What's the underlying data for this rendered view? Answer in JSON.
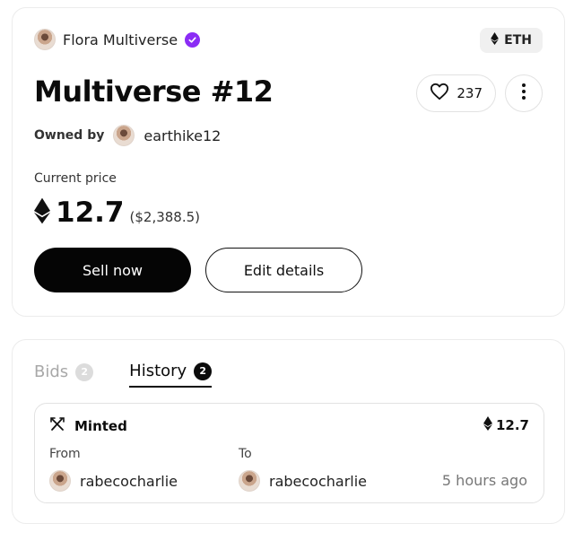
{
  "nft": {
    "collection": "Flora Multiverse",
    "chain": "ETH",
    "title": "Multiverse #12",
    "likes": "237",
    "owned_label": "Owned by",
    "owner": "earthike12",
    "price_label": "Current price",
    "price": "12.7",
    "price_usd": "($2,388.5)"
  },
  "actions": {
    "sell": "Sell now",
    "edit": "Edit details"
  },
  "tabs": [
    {
      "label": "Bids",
      "count": "2",
      "active": false
    },
    {
      "label": "History",
      "count": "2",
      "active": true
    }
  ],
  "history": [
    {
      "type": "Minted",
      "amount": "12.7",
      "from_label": "From",
      "to_label": "To",
      "from": "rabecocharlie",
      "to": "rabecocharlie",
      "time": "5 hours ago"
    }
  ],
  "icons": {
    "verified": "verified-badge-icon",
    "eth": "ethereum-icon",
    "like": "heart-icon",
    "more": "more-vertical-icon",
    "minted": "crossed-tools-icon"
  },
  "colors": {
    "verified": "#8b2cf5",
    "primary_button": "#050505"
  }
}
